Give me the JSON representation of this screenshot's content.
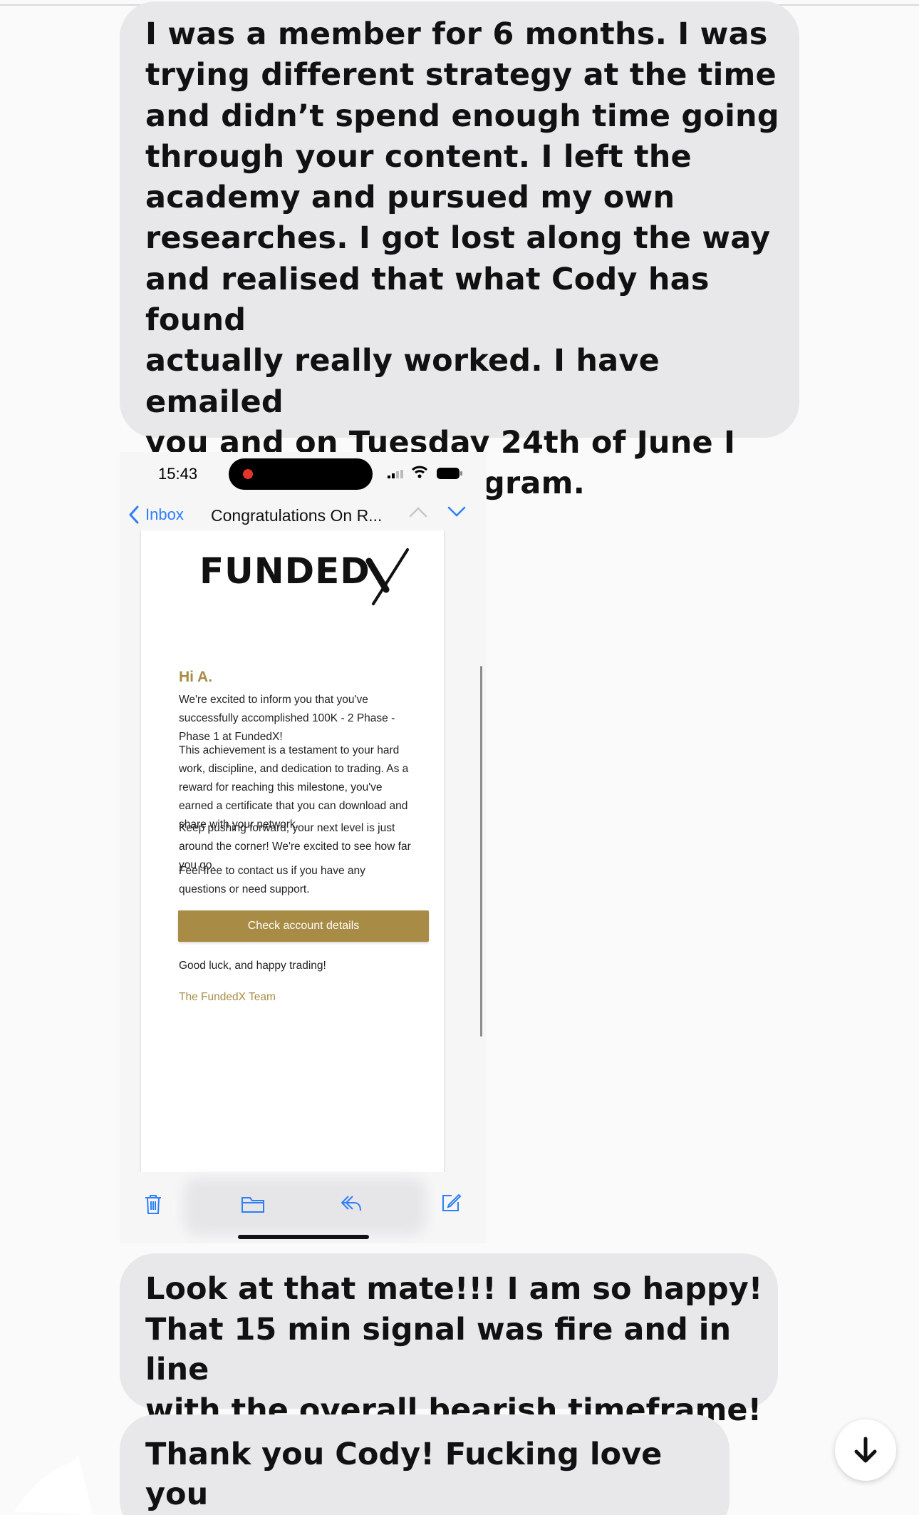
{
  "messages": [
    {
      "text": "I was a member for 6 months. I was\ntrying different strategy at the time\nand didn’t spend enough time going\nthrough your content. I left the\nacademy and pursued my own\nresearches. I got lost along the way\nand realised that what Cody has found\nactually really worked. I have emailed\nyou and on Tuesday 24th of June I\njoined back the program."
    },
    {
      "text": "Look at that mate!!! I am so happy!\nThat 15 min signal was fire and in line\nwith the overall bearish timeframe!"
    },
    {
      "text": "Thank you Cody! Fucking love you\nmate"
    }
  ],
  "screenshot": {
    "status_bar": {
      "time": "15:43"
    },
    "nav": {
      "back_label": "Inbox",
      "subject": "Congratulations On R..."
    },
    "email": {
      "logo_text": "FUNDED",
      "logo_mark": "X",
      "greeting": "Hi A.",
      "paragraphs": [
        "We're excited to inform you that you've\nsuccessfully accomplished 100K - 2 Phase -\nPhase 1 at FundedX!",
        "This achievement is a testament to your hard\nwork, discipline, and dedication to trading. As a\nreward for reaching this milestone, you've\nearned a certificate that you can download and\nshare with your network.",
        "Keep pushing forward, your next level is just\naround the corner! We're excited to see how far\nyou go.",
        "Feel free to contact us if you have any\nquestions or need support."
      ],
      "button_label": "Check account details",
      "signoff": "Good luck, and happy trading!",
      "team": "The FundedX Team"
    }
  },
  "colors": {
    "bubble": "#e8e8ea",
    "accent_gold": "#a88b45",
    "ios_blue": "#2d7ff9"
  },
  "icons": [
    "signal-icon",
    "wifi-icon",
    "battery-icon",
    "chevron-left-icon",
    "chevron-up-icon",
    "chevron-down-icon",
    "trash-icon",
    "folder-icon",
    "reply-icon",
    "compose-icon",
    "arrow-down-icon"
  ]
}
